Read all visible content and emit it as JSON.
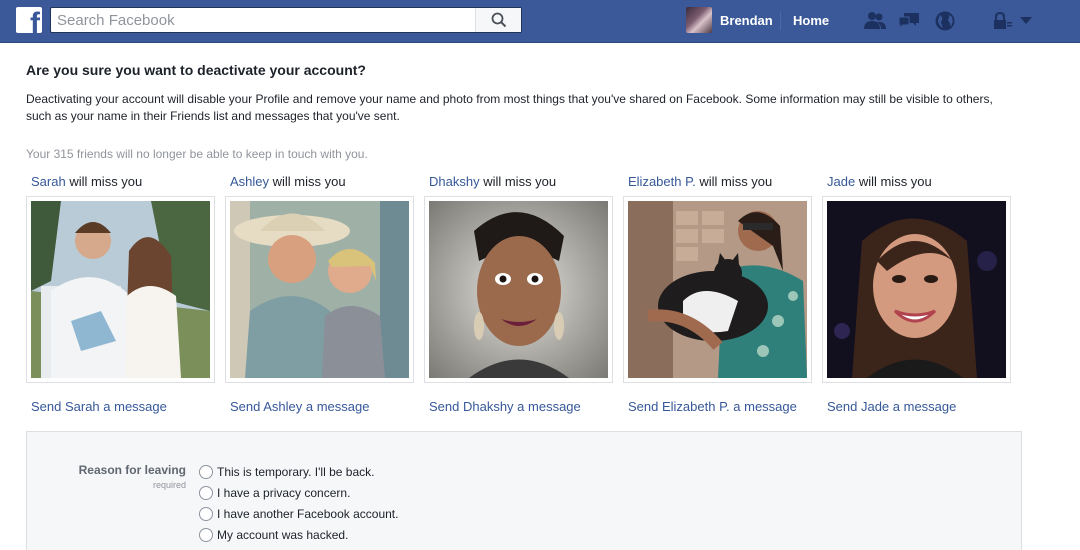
{
  "header": {
    "logo_letter": "f",
    "search_placeholder": "Search Facebook",
    "profile_name": "Brendan",
    "home_label": "Home"
  },
  "dialog": {
    "title": "Are you sure you want to deactivate your account?",
    "description": "Deactivating your account will disable your Profile and remove your name and photo from most things that you've shared on Facebook. Some information may still be visible to others, such as your name in their Friends list and messages that you've sent.",
    "friends_note": "Your 315 friends will no longer be able to keep in touch with you."
  },
  "friends": [
    {
      "name": "Sarah",
      "miss_suffix": " will miss you",
      "send_label": "Send Sarah a message"
    },
    {
      "name": "Ashley",
      "miss_suffix": " will miss you",
      "send_label": "Send Ashley a message"
    },
    {
      "name": "Dhakshy",
      "miss_suffix": " will miss you",
      "send_label": "Send Dhakshy a message"
    },
    {
      "name": "Elizabeth P.",
      "miss_suffix": " will miss you",
      "send_label": "Send Elizabeth P. a message"
    },
    {
      "name": "Jade",
      "miss_suffix": " will miss you",
      "send_label": "Send Jade a message"
    }
  ],
  "reason": {
    "label": "Reason for leaving",
    "required": "required",
    "options": [
      "This is temporary. I'll be back.",
      "I have a privacy concern.",
      "I have another Facebook account.",
      "My account was hacked."
    ]
  },
  "colors": {
    "brand": "#3b5998",
    "link": "#365899",
    "muted": "#90949c"
  }
}
